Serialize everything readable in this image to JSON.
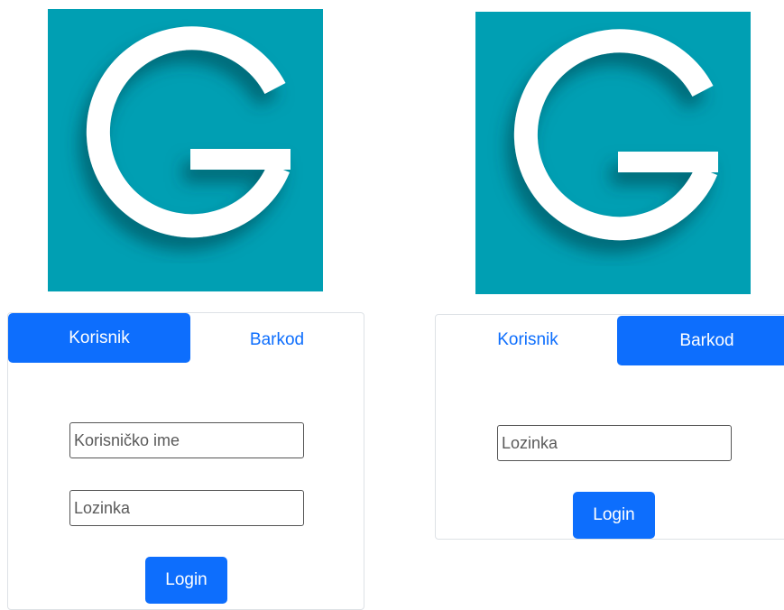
{
  "colors": {
    "logo_background": "#009fb3",
    "logo_glyph": "#ffffff",
    "primary": "#0d6efd",
    "card_border": "#dee2e6"
  },
  "left_panel": {
    "logo_icon": "letter-g-logo",
    "tabs": [
      {
        "label": "Korisnik",
        "active": true
      },
      {
        "label": "Barkod",
        "active": false
      }
    ],
    "username_placeholder": "Korisničko ime",
    "password_placeholder": "Lozinka",
    "login_label": "Login"
  },
  "right_panel": {
    "logo_icon": "letter-g-logo",
    "tabs": [
      {
        "label": "Korisnik",
        "active": false
      },
      {
        "label": "Barkod",
        "active": true
      }
    ],
    "password_placeholder": "Lozinka",
    "login_label": "Login"
  }
}
